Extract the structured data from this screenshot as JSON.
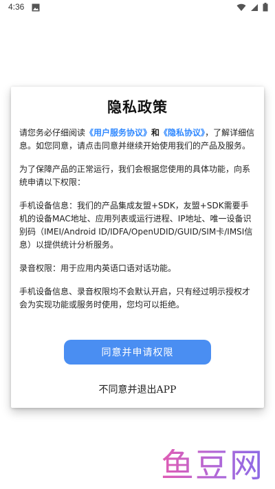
{
  "status_bar": {
    "time": "4:36",
    "left_icon": "image-icon",
    "right_icons": [
      "wifi-icon",
      "signal-icon",
      "battery-icon"
    ]
  },
  "dialog": {
    "title": "隐私政策",
    "intro": {
      "prefix": "请您务必仔细阅读",
      "link_user_agreement": "《用户服务协议》",
      "and": "和",
      "link_privacy_agreement": "《隐私协议》",
      "suffix": "，了解详细信息。如您同意，请点击同意并继续开始使用我们的产品及服务。"
    },
    "permissions_intro": "为了保障产品的正常运行，我们会根据您使用的具体功能，向系统申请以下权限：",
    "device_info": "手机设备信息：我们的产品集成友盟+SDK，友盟+SDK需要手机的设备MAC地址、应用列表或运行进程、IP地址、唯一设备识别码（IMEI/Android ID/IDFA/OpenUDID/GUID/SIM卡/IMSI信息）以提供统计分析服务。",
    "audio_permission": "录音权限：用于应用内英语口语对话功能。",
    "default_note": "手机设备信息、录音权限均不会默认开启，只有经过明示授权才会为实现功能或服务时使用，您均可以拒绝。",
    "agree_button": "同意并申请权限",
    "disagree_button": "不同意并退出APP"
  },
  "watermark": "鱼豆网",
  "colors": {
    "link": "#2f88ff",
    "button": "#4a8ef2",
    "watermark_start": "#e05cb3",
    "watermark_end": "#8a6ae6"
  }
}
